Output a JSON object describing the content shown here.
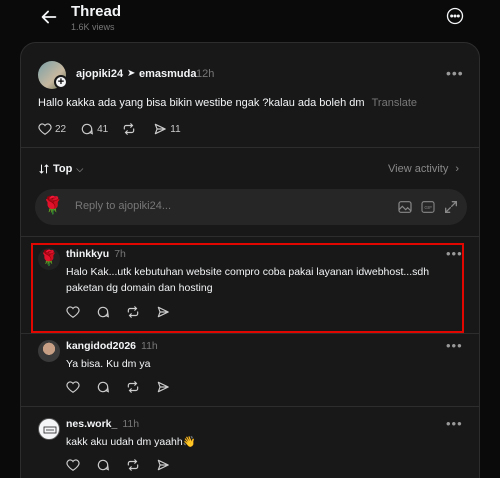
{
  "header": {
    "title": "Thread",
    "views": "1.6K views"
  },
  "post": {
    "author": "ajopiki24",
    "coauthor": "emasmuda",
    "time": "12h",
    "text": "Hallo kakka ada yang bisa bikin westibe ngak ?kalau ada boleh dm",
    "translate": "Translate",
    "likes": "22",
    "comments": "41",
    "shares": "11"
  },
  "sort": {
    "label": "Top",
    "view_activity": "View activity"
  },
  "reply": {
    "placeholder": "Reply to ajopiki24..."
  },
  "comments": [
    {
      "name": "thinkkyu",
      "time": "7h",
      "text": "Halo Kak...utk kebutuhan website compro coba pakai layanan idwebhost...sdh paketan dg domain dan hosting"
    },
    {
      "name": "kangidod2026",
      "time": "11h",
      "text": "Ya bisa. Ku dm ya"
    },
    {
      "name": "nes.work_",
      "time": "11h",
      "text": "kakk aku udah dm yaahh👋"
    }
  ],
  "colors": {
    "background": "#0a0a0a",
    "panel": "#181818",
    "highlight": "#e10600"
  }
}
